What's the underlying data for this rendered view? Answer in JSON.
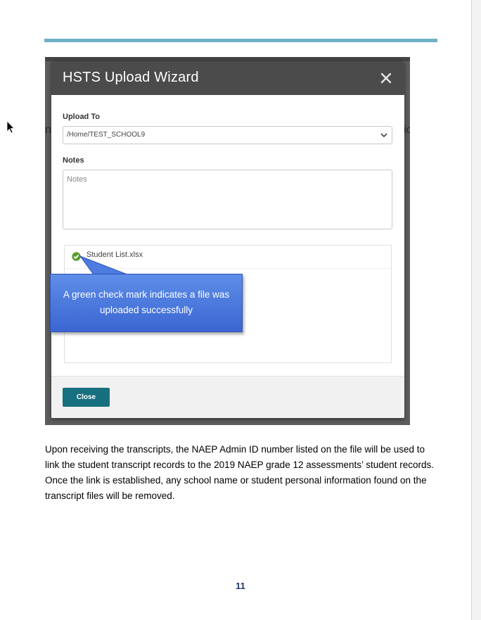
{
  "wizard": {
    "title": "HSTS Upload Wizard",
    "upload_to_label": "Upload To",
    "upload_to_value": "/Home/TEST_SCHOOL9",
    "notes_label": "Notes",
    "notes_placeholder": "Notes",
    "uploaded_file": "Student List.xlsx",
    "close_label": "Close"
  },
  "callout": {
    "text": "A green check mark indicates a file was uploaded successfully"
  },
  "body": {
    "paragraph": "Upon receiving the transcripts, the NAEP Admin ID number listed on the file will be used to link the student transcript records to the 2019 NAEP grade 12 assessments’ student records.  Once the link is established, any school name or student personal information found on the transcript files will be removed."
  },
  "footer": {
    "page_number": "11"
  },
  "colors": {
    "rule": "#6fb1c3",
    "header": "#4b4b4b",
    "button": "#17707f",
    "check": "#5a9e2f",
    "callout": "#4a78df",
    "page_number": "#1f3864"
  }
}
